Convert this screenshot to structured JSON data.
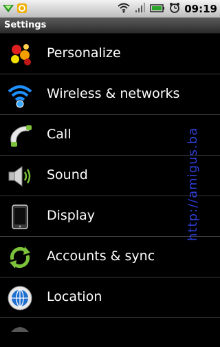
{
  "status_bar": {
    "time": "09:19",
    "icons": [
      "download-notification-icon",
      "app-notification-icon",
      "wifi-icon",
      "signal-icon",
      "battery-icon",
      "alarm-icon"
    ]
  },
  "title_bar": {
    "title": "Settings"
  },
  "menu": [
    {
      "label": "Personalize",
      "icon": "personalize-icon"
    },
    {
      "label": "Wireless & networks",
      "icon": "wireless-icon"
    },
    {
      "label": "Call",
      "icon": "phone-icon"
    },
    {
      "label": "Sound",
      "icon": "speaker-icon"
    },
    {
      "label": "Display",
      "icon": "display-icon"
    },
    {
      "label": "Accounts & sync",
      "icon": "sync-icon"
    },
    {
      "label": "Location",
      "icon": "location-icon"
    }
  ],
  "watermark": "http://amigus.ba",
  "colors": {
    "accent_green": "#7cc23a",
    "wireless_blue": "#1e90ff",
    "watermark": "#2f3fd6"
  }
}
